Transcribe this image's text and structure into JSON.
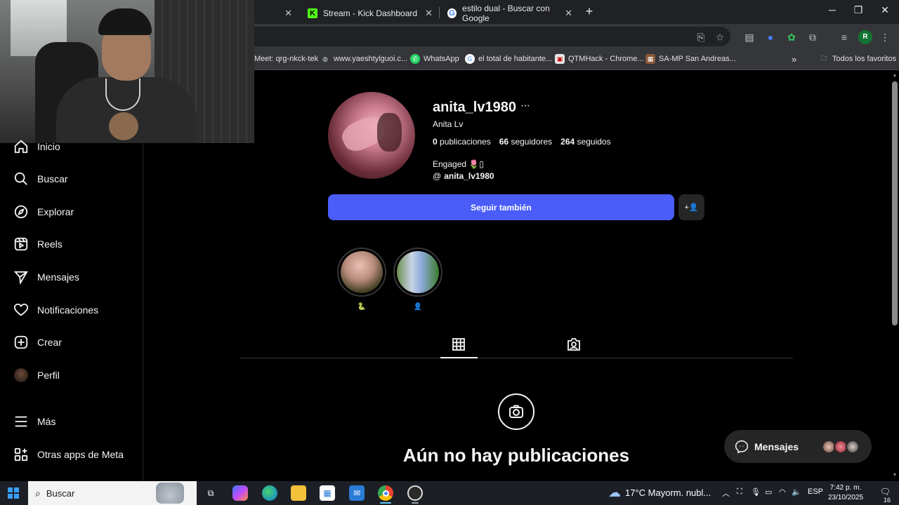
{
  "browser": {
    "tabs": [
      {
        "title": "Stream - Kick Dashboard",
        "favicon": "kick-icon"
      },
      {
        "title": "estilo dual - Buscar con Google",
        "favicon": "google-icon"
      }
    ],
    "bookmarks": [
      {
        "label": "Meet: qrg-nkck-tek"
      },
      {
        "label": "www.yaeshtylguoi.c..."
      },
      {
        "label": "WhatsApp"
      },
      {
        "label": "el total de habitante..."
      },
      {
        "label": "QTMHack - Chrome..."
      },
      {
        "label": "SA-MP San Andreas..."
      }
    ],
    "bookmarks_overflow": "»",
    "all_favorites": "Todos los favoritos",
    "profile_initial": "R"
  },
  "sidebar": {
    "items": [
      {
        "label": "Inicio",
        "icon": "home-icon"
      },
      {
        "label": "Buscar",
        "icon": "search-icon"
      },
      {
        "label": "Explorar",
        "icon": "compass-icon"
      },
      {
        "label": "Reels",
        "icon": "reels-icon"
      },
      {
        "label": "Mensajes",
        "icon": "send-icon"
      },
      {
        "label": "Notificaciones",
        "icon": "heart-icon"
      },
      {
        "label": "Crear",
        "icon": "plus-square-icon"
      },
      {
        "label": "Perfil",
        "icon": "avatar-icon"
      },
      {
        "label": "Más",
        "icon": "menu-icon"
      },
      {
        "label": "Otras apps de Meta",
        "icon": "meta-apps-icon"
      }
    ]
  },
  "profile": {
    "username": "anita_lv1980",
    "full_name": "Anita Lv",
    "stats": {
      "posts_count": "0",
      "posts_label": "publicaciones",
      "followers_count": "66",
      "followers_label": "seguidores",
      "following_count": "264",
      "following_label": "seguidos"
    },
    "bio": "Engaged 🌷▯",
    "threads_handle": "anita_lv1980",
    "follow_button": "Seguir también",
    "suggest_icon": "+👤",
    "highlights": [
      {
        "label": "🐍"
      },
      {
        "label": "👤"
      }
    ],
    "empty_title": "Aún no hay publicaciones"
  },
  "messages_pill": {
    "label": "Mensajes"
  },
  "taskbar": {
    "search_label": "Buscar",
    "weather": "17°C  Mayorm. nubl...",
    "language": "ESP",
    "time": "7:42 p. m.",
    "date": "23/10/2025",
    "notification_count": "16"
  }
}
